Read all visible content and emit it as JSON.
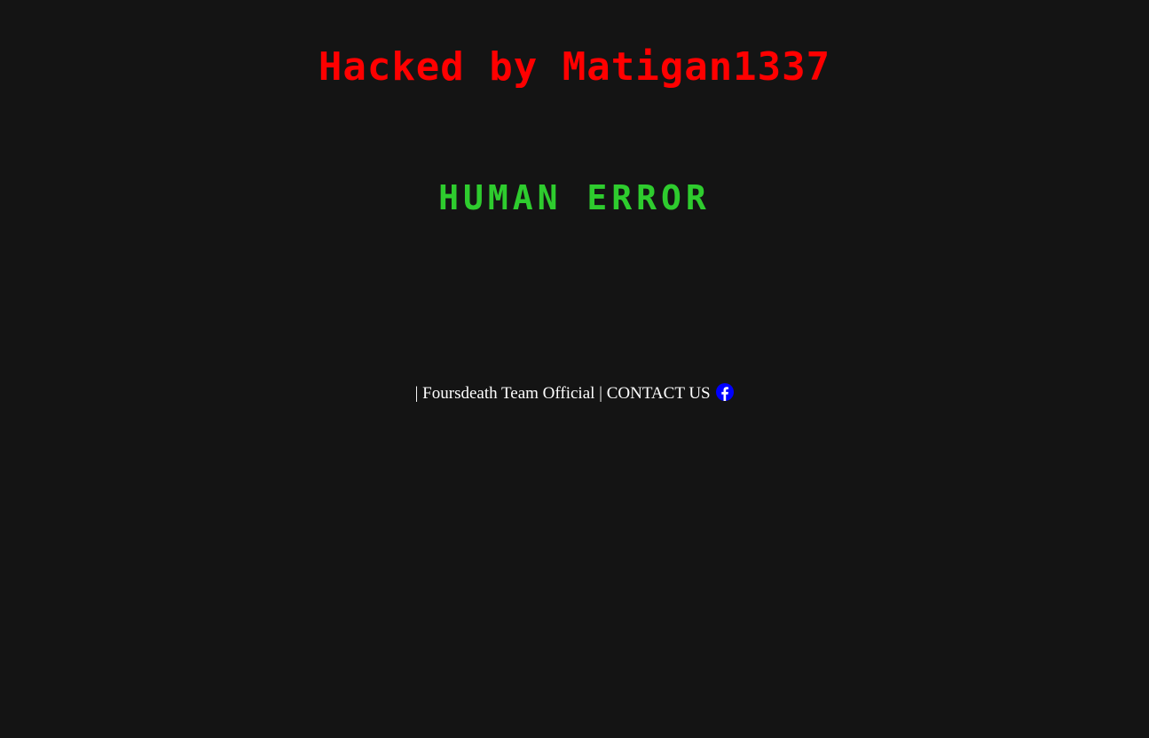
{
  "header": {
    "title": "Hacked by Matigan1337",
    "title_color": "#ff0000"
  },
  "main": {
    "subtitle": "HUMAN ERROR",
    "subtitle_color": "#2ecc2e"
  },
  "footer": {
    "separator_left": "| ",
    "team_name": "Foursdeath Team Official",
    "separator_mid": " | ",
    "contact_label": "CONTACT US",
    "contact_icon": "facebook-icon",
    "icon_color": "#0000ff"
  },
  "background_color": "#141414"
}
